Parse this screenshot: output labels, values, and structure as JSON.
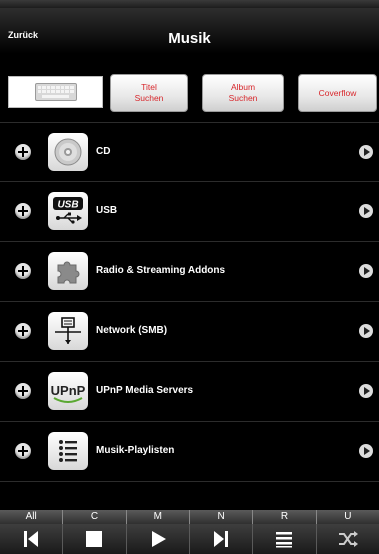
{
  "header": {
    "back_label": "Zurück",
    "title": "Musik"
  },
  "toolbar": {
    "keyboard_icon": "keyboard-icon",
    "title_search_label": "Titel Suchen",
    "album_search_label": "Album Suchen",
    "coverflow_label": "Coverflow"
  },
  "list": {
    "items": [
      {
        "label": "CD",
        "icon": "cd-icon"
      },
      {
        "label": "USB",
        "icon": "usb-icon"
      },
      {
        "label": "Radio & Streaming Addons",
        "icon": "puzzle-icon"
      },
      {
        "label": "Network (SMB)",
        "icon": "network-icon"
      },
      {
        "label": "UPnP Media Servers",
        "icon": "upnp-icon"
      },
      {
        "label": "Musik-Playlisten",
        "icon": "playlist-icon"
      }
    ]
  },
  "alphabet": [
    "All",
    "C",
    "M",
    "N",
    "R",
    "U"
  ],
  "transport": [
    "previous-icon",
    "stop-icon",
    "play-icon",
    "next-icon",
    "playlist-icon",
    "shuffle-icon"
  ],
  "colors": {
    "accent_text": "#d8262b",
    "background": "#000000"
  }
}
